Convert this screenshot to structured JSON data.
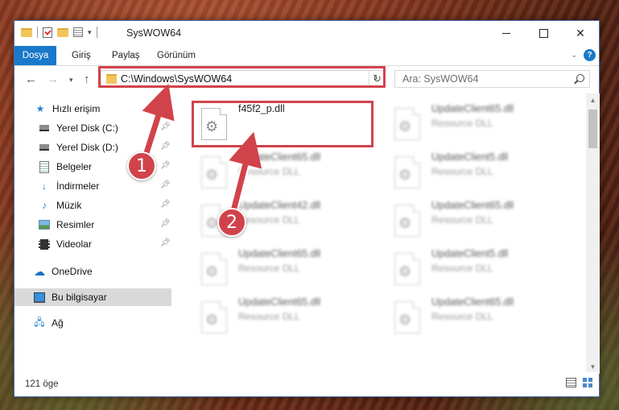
{
  "window": {
    "title": "SysWOW64"
  },
  "ribbon": {
    "file_tab": "Dosya",
    "tabs": [
      "Giriş",
      "Paylaş",
      "Görünüm"
    ]
  },
  "address": {
    "path": "C:\\Windows\\SysWOW64"
  },
  "search": {
    "placeholder": "Ara: SysWOW64"
  },
  "sidebar": {
    "items": [
      {
        "label": "Hızlı erişim",
        "icon": "star-icon"
      },
      {
        "label": "Yerel Disk (C:)",
        "icon": "drive-icon",
        "pinned": true
      },
      {
        "label": "Yerel Disk (D:)",
        "icon": "drive-icon",
        "pinned": true
      },
      {
        "label": "Belgeler",
        "icon": "documents-icon",
        "pinned": true
      },
      {
        "label": "İndirmeler",
        "icon": "download-icon",
        "pinned": true
      },
      {
        "label": "Müzik",
        "icon": "music-icon",
        "pinned": true
      },
      {
        "label": "Resimler",
        "icon": "pictures-icon",
        "pinned": true
      },
      {
        "label": "Videolar",
        "icon": "videos-icon",
        "pinned": true
      },
      {
        "label": "OneDrive",
        "icon": "cloud-icon"
      },
      {
        "label": "Bu bilgisayar",
        "icon": "computer-icon",
        "selected": true
      },
      {
        "label": "Ağ",
        "icon": "network-icon"
      }
    ]
  },
  "files": [
    {
      "name": "f45f2_p.dll",
      "type": ""
    },
    {
      "name": "UpdateClient65.dll",
      "type": "Resource DLL"
    },
    {
      "name": "UpdateClient65.dll",
      "type": "Resource DLL"
    },
    {
      "name": "UpdateClient5.dll",
      "type": "Resource DLL"
    },
    {
      "name": "UpdateClient42.dll",
      "type": "Resource DLL"
    },
    {
      "name": "UpdateClient65.dll",
      "type": "Resource DLL"
    },
    {
      "name": "UpdateClient65.dll",
      "type": "Resource DLL"
    },
    {
      "name": "UpdateClient5.dll",
      "type": "Resource DLL"
    },
    {
      "name": "UpdateClient65.dll",
      "type": "Resource DLL"
    },
    {
      "name": "UpdateClient65.dll",
      "type": "Resource DLL"
    }
  ],
  "status": {
    "count": "121 öge"
  },
  "annotations": {
    "step1": "1",
    "step2": "2",
    "color": "#d1434b"
  }
}
